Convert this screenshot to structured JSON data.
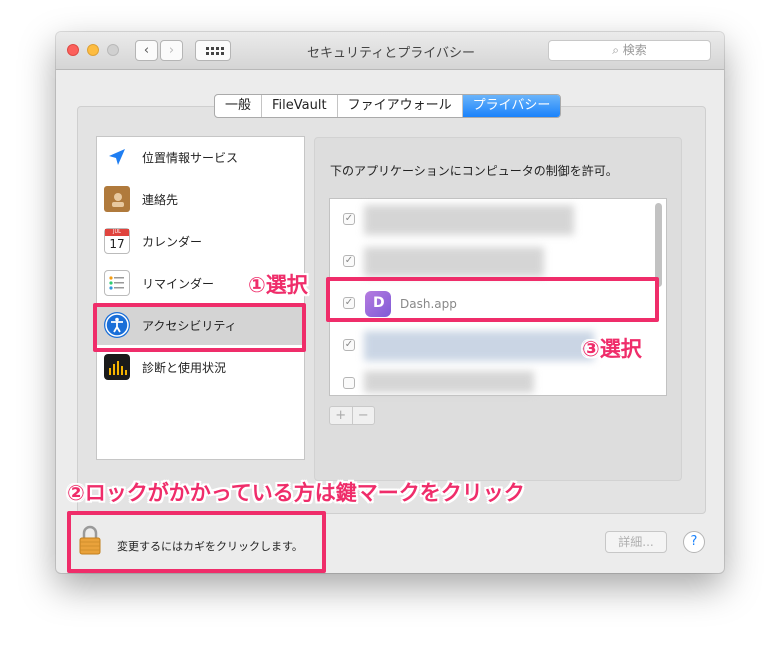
{
  "window": {
    "title": "セキュリティとプライバシー",
    "search_placeholder": "検索"
  },
  "tabs": [
    {
      "label": "一般",
      "active": false
    },
    {
      "label": "FileVault",
      "active": false
    },
    {
      "label": "ファイアウォール",
      "active": false
    },
    {
      "label": "プライバシー",
      "active": true
    }
  ],
  "sidebar": {
    "items": [
      {
        "label": "位置情報サービス",
        "icon": "location-arrow-icon"
      },
      {
        "label": "連絡先",
        "icon": "contacts-book-icon"
      },
      {
        "label": "カレンダー",
        "icon": "calendar-icon",
        "icon_text_month": "JUL",
        "icon_text_day": "17"
      },
      {
        "label": "リマインダー",
        "icon": "reminders-icon"
      },
      {
        "label": "アクセシビリティ",
        "icon": "accessibility-icon",
        "selected": true
      },
      {
        "label": "診断と使用状況",
        "icon": "diagnostics-icon"
      }
    ]
  },
  "main": {
    "description": "下のアプリケーションにコンピュータの制御を許可。",
    "apps": [
      {
        "name": "",
        "checked": true,
        "blurred": true
      },
      {
        "name": "",
        "checked": true,
        "blurred": true
      },
      {
        "name": "Dash.app",
        "checked": true,
        "blurred": false
      },
      {
        "name": "",
        "checked": true,
        "blurred": true
      },
      {
        "name": "",
        "checked": false,
        "blurred": true
      }
    ],
    "add_label": "+",
    "remove_label": "−"
  },
  "footer": {
    "lock_text": "変更するにはカギをクリックします。",
    "detail_label": "詳細...",
    "help_label": "?"
  },
  "annotations": {
    "step1": "①選択",
    "step2": "②ロックがかかっている方は鍵マークをクリック",
    "step3": "③選択",
    "color": "#ef2d6a"
  },
  "colors": {
    "accent": "#1a82fb",
    "annotation": "#ef2d6a"
  }
}
